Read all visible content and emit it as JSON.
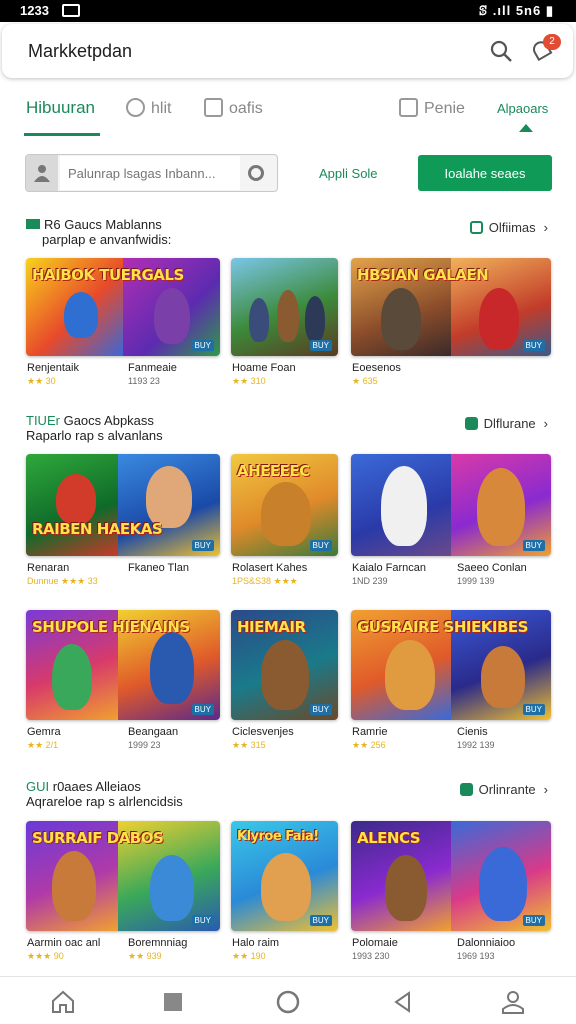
{
  "status_bar": {
    "time": "1233",
    "right": "ꕷ .ıll 5n6 ▮"
  },
  "app_bar": {
    "title": "Markketpdan",
    "notification_badge": "2"
  },
  "tabs": [
    {
      "label": "Hibuuran",
      "active": true
    },
    {
      "label": "hlit"
    },
    {
      "label": "oafis"
    },
    {
      "label": "Penie"
    }
  ],
  "tab_right_label": "Alpaoars",
  "search": {
    "placeholder": "Palunrap lsagas Inbann..."
  },
  "app_link": "Appli Sole",
  "primary_button": "Ioalahe seaes",
  "sections": [
    {
      "flag": "R6",
      "title_line1": "Gaucs Mablanns",
      "title_line2": "parplap e anvanfwidis:",
      "more": "Olfiimas",
      "rows": [
        [
          {
            "headline": "HAIBOK  TUERGALS",
            "name": "Renjentaik",
            "meta": "★★ 30",
            "tag": "BUY"
          },
          {
            "headline": "",
            "name": "Hoame Foan",
            "meta": "★★ 310",
            "tag": "BUY"
          },
          {
            "headline": "HBSIAN  GALAEN",
            "name": "Eoesenos",
            "meta": "★ 635",
            "tag": "BUY"
          }
        ]
      ],
      "row_extra": [
        {
          "name": "Fanmeaie",
          "meta": "1193 23"
        },
        null,
        {
          "name": "",
          "meta": ""
        }
      ]
    },
    {
      "flag": "TIUEr",
      "title_line1": "Gaocs Abpkass",
      "title_line2": "Raparlo rap s alvanlans",
      "more": "Dlflurane",
      "rows": [
        [
          {
            "headline": "RAIBEN  HAEKAS",
            "name": "Renaran",
            "meta": "Dunnue ★★★ 33",
            "tag": "BUY"
          },
          {
            "headline": "AHEEEEC",
            "name": "Rolasert Kahes",
            "meta": "1PS&S38  ★★★",
            "tag": "BUY"
          },
          {
            "headline": "",
            "name": "Kaialo Farncan",
            "meta": "1ND 239",
            "tag": "BUY"
          }
        ],
        [
          {
            "headline": "SHUPOLE  HIENAINS",
            "name": "Gemra",
            "meta": "★★ 2/1",
            "tag": "BUY"
          },
          {
            "headline": "HIEMAIR",
            "name": "Ciclesvenjes",
            "meta": "★★ 315",
            "tag": "BUY"
          },
          {
            "headline": "GUSRAIRE  SHIEKIBES",
            "name": "Ramrie",
            "meta": "★★ 256",
            "tag": "BUY"
          }
        ]
      ],
      "row_extra": [
        [
          {
            "name": "Fkaneo Tlan",
            "meta": ""
          },
          null,
          {
            "name": "Saeeo Conlan",
            "meta": "1999 139"
          }
        ],
        [
          {
            "name": "Beangaan",
            "meta": "1999 23"
          },
          null,
          {
            "name": "Cienis",
            "meta": "1992 139"
          }
        ]
      ]
    },
    {
      "flag": "GUI",
      "title_line1": "r0aaes Alleiaos",
      "title_line2": "Aqrareloe rap s alrlencidsis",
      "more": "Orlinrante",
      "rows": [
        [
          {
            "headline": "SURRAIF  DABOS",
            "name": "Aarmin oac anl",
            "meta": "★★★ 90",
            "tag": "BUY"
          },
          {
            "headline": "Klyroe Faia!",
            "name": "Halo raim",
            "meta": "★★ 190",
            "tag": "BUY"
          },
          {
            "headline": "ALENCS",
            "name": "Polomaie",
            "meta": "1993 230",
            "tag": "BUY"
          }
        ]
      ],
      "row_extra": [
        {
          "name": "Boremnniag",
          "meta": "★★ 939"
        },
        null,
        {
          "name": "Dalonniaioo",
          "meta": "1969 193"
        }
      ]
    }
  ],
  "nav": [
    "home-icon",
    "recents-icon",
    "circle-icon",
    "back-icon",
    "profile-icon"
  ]
}
